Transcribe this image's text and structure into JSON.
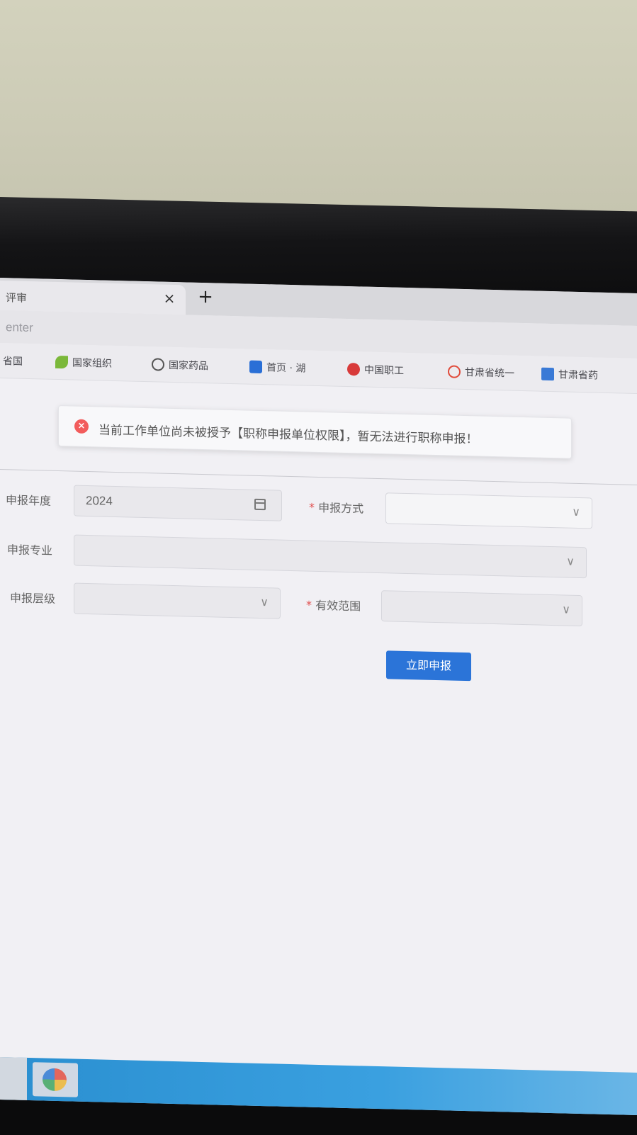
{
  "browser": {
    "tab_title": "评审",
    "close_glyph": "×",
    "new_tab_glyph": "+",
    "url": "enter",
    "bookmarks": [
      {
        "label": "省国",
        "color": "#ccc"
      },
      {
        "label": "国家组织",
        "color": "#7bb83a"
      },
      {
        "label": "国家药品",
        "color": "#555"
      },
      {
        "label": "首页 · 湖",
        "color": "#2a6fd6"
      },
      {
        "label": "中国职工",
        "color": "#d83a3a"
      },
      {
        "label": "甘肃省统一",
        "color": "#e04a3a"
      },
      {
        "label": "甘肃省药",
        "color": "#3a7ad6"
      }
    ]
  },
  "alert": {
    "icon": "×",
    "message": "当前工作单位尚未被授予【职称申报单位权限】，暂无法进行职称申报！"
  },
  "form": {
    "year_label": "申报年度",
    "year_value": "2024",
    "method_label": "申报方式",
    "major_label": "申报专业",
    "level_label": "申报层级",
    "scope_label": "有效范围",
    "required_mark": "*",
    "chevron": "∨",
    "submit_label": "立即申报"
  }
}
